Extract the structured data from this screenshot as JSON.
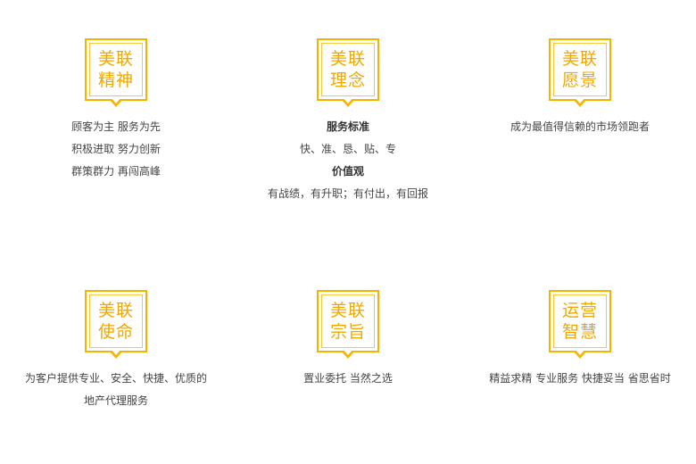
{
  "cards": [
    {
      "badge": [
        "美联",
        "精神"
      ],
      "lines": [
        {
          "text": "顾客为主  服务为先"
        },
        {
          "text": "积极进取  努力创新"
        },
        {
          "text": "群策群力  再闯高峰"
        }
      ]
    },
    {
      "badge": [
        "美联",
        "理念"
      ],
      "lines": [
        {
          "text": "服务标准",
          "bold": true
        },
        {
          "text": "快、准、恳、贴、专"
        },
        {
          "text": "价值观",
          "bold": true
        },
        {
          "text": "有战绩，有升职；有付出，有回报"
        }
      ]
    },
    {
      "badge": [
        "美联",
        "愿景"
      ],
      "lines": [
        {
          "text": "成为最值得信赖的市场领跑者"
        }
      ]
    },
    {
      "badge": [
        "美联",
        "使命"
      ],
      "lines": [
        {
          "text": "为客户提供专业、安全、快捷、优质的"
        },
        {
          "text": "地产代理服务"
        }
      ]
    },
    {
      "badge": [
        "美联",
        "宗旨"
      ],
      "lines": [
        {
          "text": "置业委托  当然之选"
        }
      ]
    },
    {
      "badge": [
        "运营",
        "智慧"
      ],
      "lines": [
        {
          "text": "精益求精  专业服务  快捷妥当  省思省时"
        }
      ]
    }
  ]
}
